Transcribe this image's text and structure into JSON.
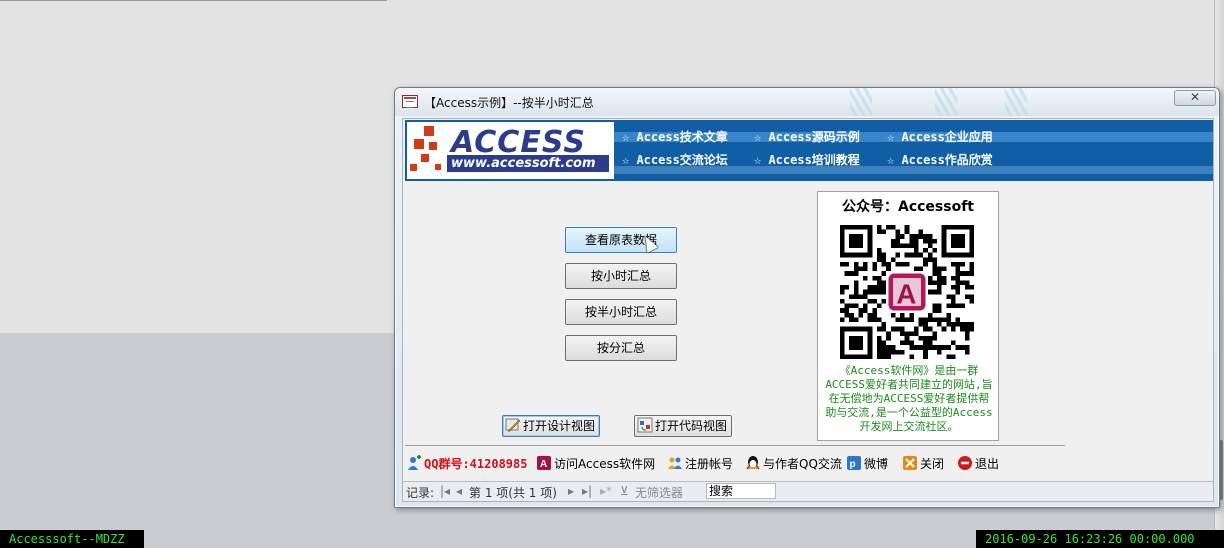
{
  "window": {
    "title": "【Access示例】--按半小时汇总",
    "close_label": "✕"
  },
  "banner": {
    "logo_text": "ACCESS",
    "logo_url": "www.accessoft.com",
    "nav_links": [
      "☆ Access技术文章",
      "☆ Access源码示例",
      "☆ Access企业应用",
      "☆ Access交流论坛",
      "☆ Access培训教程",
      "☆ Access作品欣赏"
    ]
  },
  "buttons": {
    "view_raw": "查看原表数据",
    "by_hour": "按小时汇总",
    "by_half_hour": "按半小时汇总",
    "by_minute": "按分汇总",
    "open_design": "打开设计视图",
    "open_code": "打开代码视图"
  },
  "qr_panel": {
    "title": "公众号：Accessoft",
    "description": "《Access软件网》是由一群ACCESS爱好者共同建立的网站,旨在无偿地为ACCESS爱好者提供帮助与交流,是一个公益型的Access开发网上交流社区。"
  },
  "footer": {
    "qq_group": "QQ群号:41208985",
    "visit_site": "访问Access软件网",
    "register": "注册帐号",
    "contact_author": "与作者QQ交流",
    "weibo": "微博",
    "close": "关闭",
    "exit": "退出"
  },
  "record_nav": {
    "label": "记录:",
    "position": "第 1 项(共 1 项)",
    "filter": "无筛选器",
    "search_placeholder": "搜索"
  },
  "status": {
    "left": "Accesssoft--MDZZ",
    "right": "2016-09-26 16:23:26 00:00.000"
  },
  "colors": {
    "banner_blue": "#0f5ea6",
    "qq_red": "#d0101a",
    "desc_green": "#1a8a1a",
    "status_green": "#36e636"
  }
}
